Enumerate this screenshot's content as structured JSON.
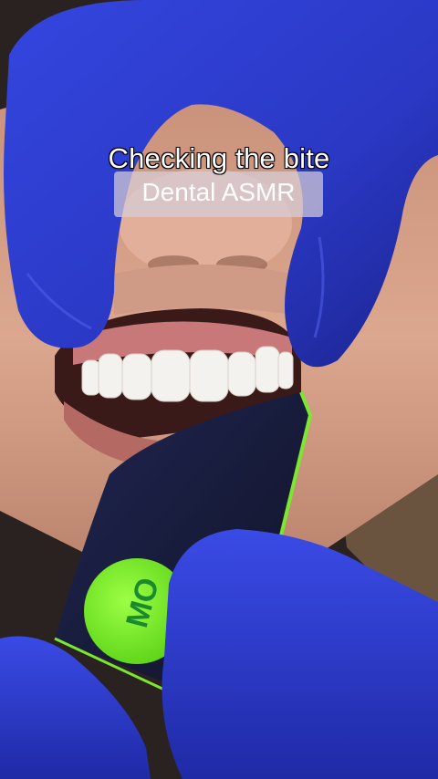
{
  "overlay": {
    "title": "Checking the bite",
    "subtitle": "Dental ASMR"
  },
  "photo": {
    "subject": "dental-bite-check",
    "card_logo_text": "MO",
    "colors": {
      "glove": "#2f3fd6",
      "glove_shadow": "#1a238a",
      "skin": "#d9a48a",
      "gum": "#c9787a",
      "teeth": "#f4f2ee",
      "card": "#1c2040",
      "logo": "#7df22a"
    }
  }
}
